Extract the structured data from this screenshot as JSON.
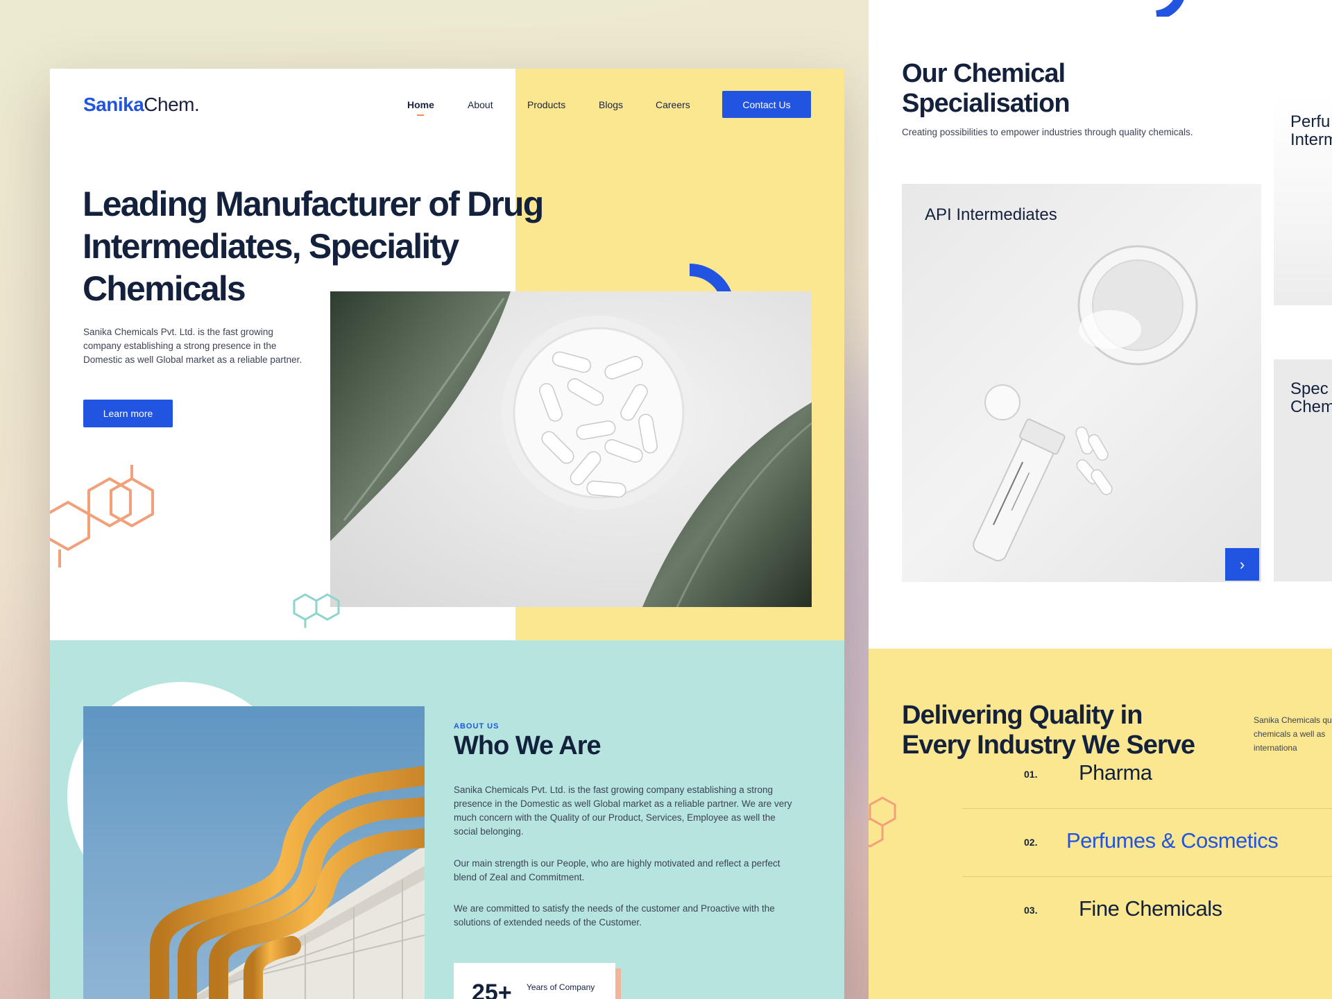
{
  "brand": {
    "name_bold": "Sanika",
    "name_rest": "Chem."
  },
  "nav": {
    "items": [
      "Home",
      "About",
      "Products",
      "Blogs",
      "Careers"
    ],
    "contact_label": "Contact Us"
  },
  "hero": {
    "title": "Leading Manufacturer of Drug Intermediates, Speciality Chemicals",
    "description": "Sanika Chemicals Pvt. Ltd. is the fast growing company establishing a strong presence in the Domestic as well Global market as a reliable partner.",
    "cta_label": "Learn more"
  },
  "about": {
    "tag": "ABOUT US",
    "title": "Who We Are",
    "paragraphs": [
      "Sanika Chemicals Pvt. Ltd. is the fast growing company establishing a strong presence in the Domestic as well Global market as a reliable partner. We are very much concern with the Quality of our Product, Services, Employee as well the social belonging.",
      "Our main strength is our People, who are highly motivated and reflect a perfect blend of Zeal and Commitment.",
      "We are committed to satisfy the needs of the customer and Proactive with the solutions of extended needs of the Customer."
    ],
    "stat_value": "25+",
    "stat_label": "Years of Company"
  },
  "specialisation": {
    "title": "Our Chemical Specialisation",
    "subtitle": "Creating possibilities to empower industries through quality chemicals.",
    "cards": [
      "API Intermediates",
      "Perfu Interm",
      "Spec Chem"
    ]
  },
  "industries": {
    "title": "Delivering Quality in Every Industry We Serve",
    "description": "Sanika Chemicals quality chemicals a well as internationa",
    "items": [
      {
        "num": "01.",
        "name": "Pharma"
      },
      {
        "num": "02.",
        "name": "Perfumes & Cosmetics"
      },
      {
        "num": "03.",
        "name": "Fine Chemicals"
      }
    ]
  },
  "colors": {
    "accent": "#2154e0",
    "yellow": "#fbe78f",
    "teal": "#b6e4de",
    "orange": "#f08a5d",
    "navy": "#14213d"
  }
}
